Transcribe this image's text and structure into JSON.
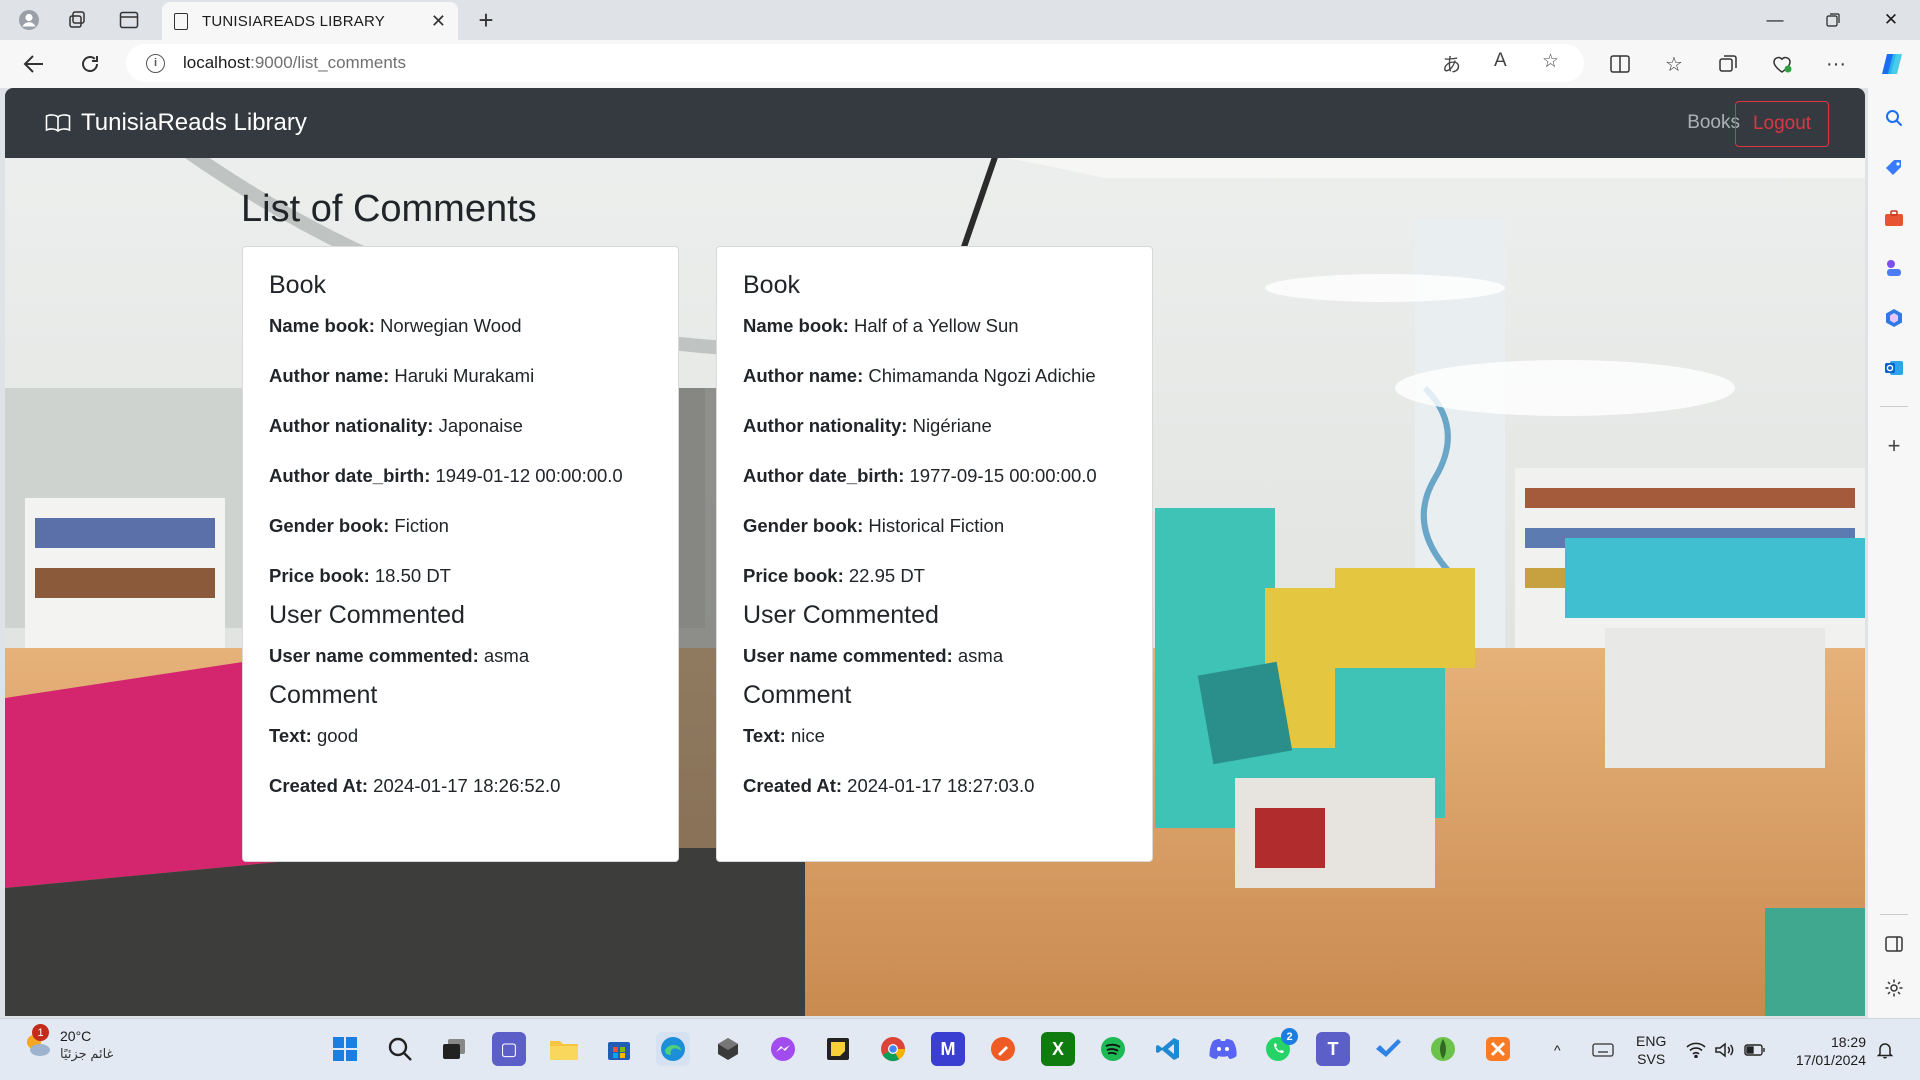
{
  "browser": {
    "tab_title": "TUNISIAREADS LIBRARY",
    "url_host": "localhost",
    "url_path": ":9000/list_comments"
  },
  "app": {
    "brand": "TunisiaReads Library",
    "nav_books": "Books",
    "nav_logout": "Logout"
  },
  "page": {
    "title": "List of Comments"
  },
  "labels": {
    "book_section": "Book",
    "name_book": "Name book:",
    "author_name": "Author name:",
    "author_nationality": "Author nationality:",
    "author_date_birth": "Author date_birth:",
    "gender_book": "Gender book:",
    "price_book": "Price book:",
    "user_section": "User Commented",
    "user_name": "User name commented:",
    "comment_section": "Comment",
    "text": "Text:",
    "created_at": "Created At:"
  },
  "comments": [
    {
      "name_book": "Norwegian Wood",
      "author_name": "Haruki Murakami",
      "author_nationality": "Japonaise",
      "author_date_birth": "1949-01-12 00:00:00.0",
      "gender_book": "Fiction",
      "price_book": "18.50 DT",
      "user_name": "asma",
      "text": "good",
      "created_at": "2024-01-17 18:26:52.0"
    },
    {
      "name_book": "Half of a Yellow Sun",
      "author_name": "Chimamanda Ngozi Adichie",
      "author_nationality": "Nigériane",
      "author_date_birth": "1977-09-15 00:00:00.0",
      "gender_book": "Historical Fiction",
      "price_book": "22.95 DT",
      "user_name": "asma",
      "text": "nice",
      "created_at": "2024-01-17 18:27:03.0"
    }
  ],
  "taskbar": {
    "weather_temp": "20°C",
    "weather_cond": "غائم جزئيًا",
    "weather_badge": "1",
    "whatsapp_badge": "2",
    "lang_top": "ENG",
    "lang_bottom": "SVS",
    "time": "18:29",
    "date": "17/01/2024"
  }
}
